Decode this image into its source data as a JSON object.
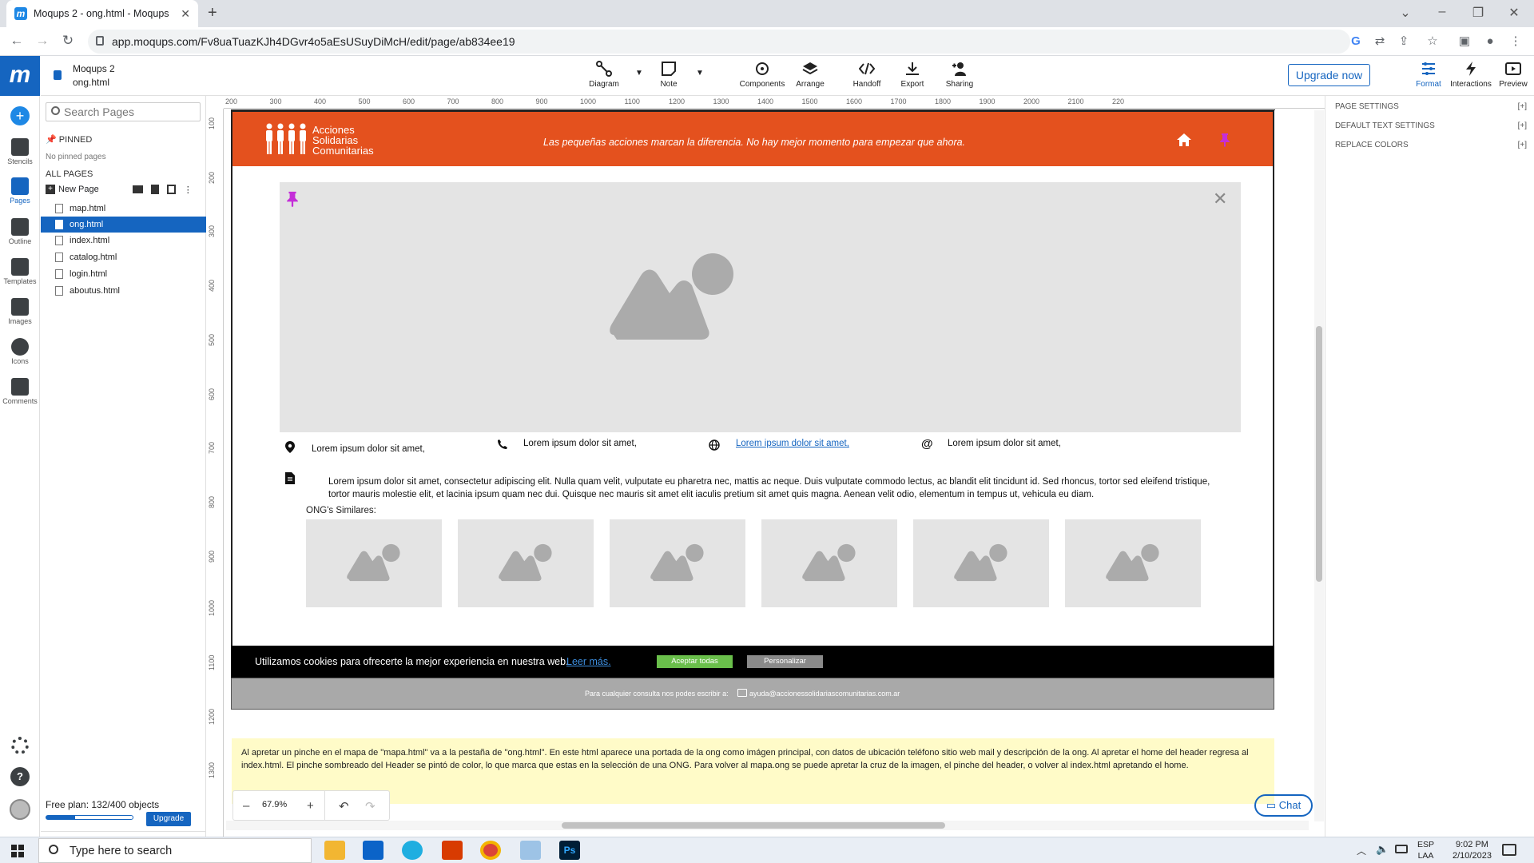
{
  "browser": {
    "tab_title": "Moqups 2 - ong.html - Moqups",
    "favicon": "m",
    "url": "app.moqups.com/Fv8uaTuazKJh4DGvr4o5aEsUSuyDiMcH/edit/page/ab834ee19"
  },
  "app": {
    "project_name": "Moqups 2",
    "page_name": "ong.html",
    "logo": "m",
    "rail": [
      {
        "label": "Stencils"
      },
      {
        "label": "Pages"
      },
      {
        "label": "Outline"
      },
      {
        "label": "Templates"
      },
      {
        "label": "Images"
      },
      {
        "label": "Icons"
      },
      {
        "label": "Comments"
      }
    ],
    "tools": [
      {
        "label": "Diagram"
      },
      {
        "label": "Note"
      },
      {
        "label": "Components"
      },
      {
        "label": "Arrange"
      },
      {
        "label": "Handoff"
      },
      {
        "label": "Export"
      },
      {
        "label": "Sharing"
      }
    ],
    "upgrade_now": "Upgrade now",
    "right_tools": [
      {
        "label": "Format"
      },
      {
        "label": "Interactions"
      },
      {
        "label": "Preview"
      }
    ]
  },
  "pages_panel": {
    "search_placeholder": "Search Pages",
    "pinned_label": "PINNED",
    "no_pinned": "No pinned pages",
    "all_pages_label": "ALL PAGES",
    "new_page": "New Page",
    "pages": [
      "map.html",
      "ong.html",
      "index.html",
      "catalog.html",
      "login.html",
      "aboutus.html"
    ],
    "selected_page": "ong.html",
    "free_plan": "Free plan: 132/400 objects",
    "plan_usage": 0.33,
    "upgrade": "Upgrade"
  },
  "rulers": {
    "top": [
      "200",
      "300",
      "400",
      "500",
      "600",
      "700",
      "800",
      "900",
      "1000",
      "1100",
      "1200",
      "1300",
      "1400",
      "1500",
      "1600",
      "1700",
      "1800",
      "1900",
      "2000",
      "2100",
      "220"
    ],
    "left": [
      "100",
      "200",
      "300",
      "400",
      "500",
      "600",
      "700",
      "800",
      "900",
      "1000",
      "1100",
      "1200",
      "1300"
    ]
  },
  "mockup": {
    "logo_lines": [
      "Acciones",
      "Solidarias",
      "Comunitarias"
    ],
    "slogan": "Las pequeñas acciones marcan la diferencia. No hay mejor momento para empezar que ahora.",
    "address": "Lorem ipsum dolor sit amet,",
    "phone": "Lorem ipsum dolor sit amet,",
    "website": "Lorem ipsum dolor sit amet,",
    "email": "Lorem ipsum dolor sit amet,",
    "description": "Lorem ipsum dolor sit amet, consectetur adipiscing elit. Nulla quam velit, vulputate eu pharetra nec, mattis ac neque. Duis vulputate commodo lectus, ac blandit elit tincidunt id. Sed rhoncus, tortor sed eleifend tristique, tortor mauris molestie elit, et lacinia ipsum quam nec dui. Quisque nec mauris sit amet elit iaculis pretium sit amet quis magna. Aenean velit odio, elementum in tempus ut, vehicula eu diam.",
    "similares_label": "ONG's Similares:",
    "cookie_text": "Utilizamos cookies para ofrecerte la mejor experiencia en nuestra web.",
    "cookie_link": "Leer más.",
    "accept_all": "Aceptar todas",
    "customize": "Personalizar",
    "footer_text": "Para cualquier consulta nos podes escribir a:",
    "footer_email": "ayuda@accionessolidariascomunitarias.com.ar",
    "header_color": "#e4511e"
  },
  "note": "Al apretar un pinche en el mapa de \"mapa.html\" va a la pestaña de \"ong.html\". En este html aparece una portada de la ong como imágen principal, con datos de ubicación teléfono sitio web mail y descripción de la ong. Al apretar el home del header regresa al index.html. El pinche sombreado del Header se pintó de color, lo que marca que estas en la selección de una ONG. Para volver al mapa.ong se puede apretar la cruz de la imagen, el pinche del header, o volver al index.html apretando el home.",
  "zoom": "67.9%",
  "chat": "Chat",
  "right_panel": {
    "rows": [
      "PAGE SETTINGS",
      "DEFAULT TEXT SETTINGS",
      "REPLACE COLORS"
    ],
    "expand": "[+]"
  },
  "taskbar": {
    "search_placeholder": "Type here to search",
    "lang": "ESP",
    "lang2": "LAA",
    "time": "9:02 PM",
    "date": "2/10/2023"
  }
}
